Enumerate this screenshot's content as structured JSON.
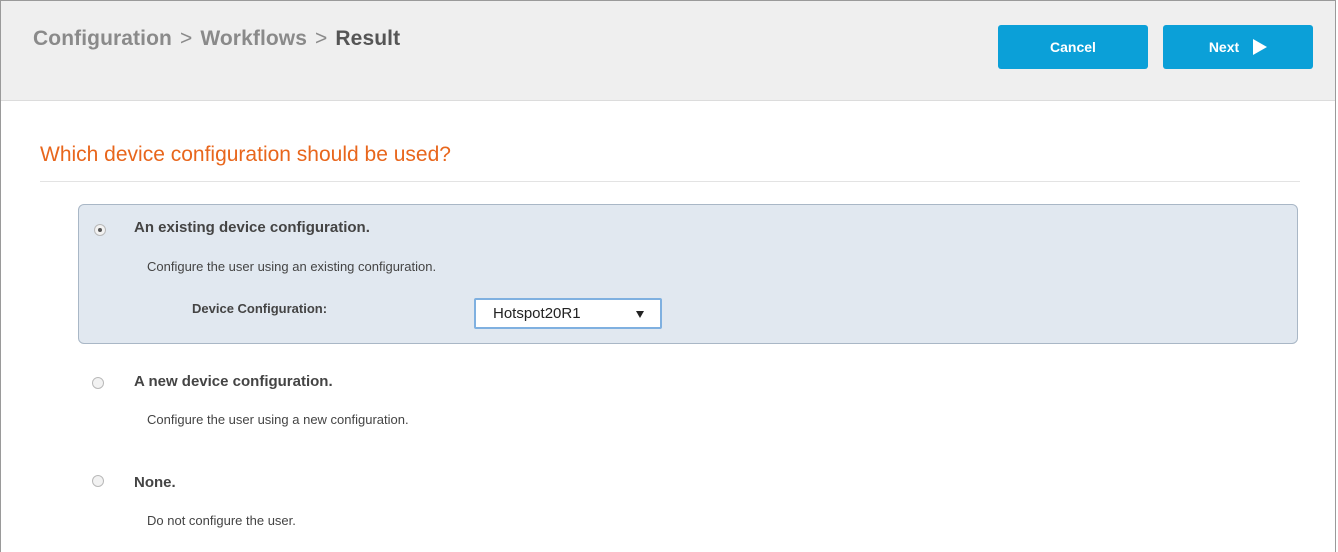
{
  "breadcrumb": {
    "item1": "Configuration",
    "item2": "Workflows",
    "current": "Result",
    "separator": ">"
  },
  "toolbar": {
    "cancel_label": "Cancel",
    "next_label": "Next"
  },
  "question": "Which device configuration should be used?",
  "options": [
    {
      "label": "An existing device configuration.",
      "description": "Configure the user using an existing configuration.",
      "selected": true
    },
    {
      "label": "A new device configuration.",
      "description": "Configure the user using a new configuration.",
      "selected": false
    },
    {
      "label": "None.",
      "description": "Do not configure the user.",
      "selected": false
    }
  ],
  "device_config": {
    "label": "Device Configuration:",
    "selected_value": "Hotspot20R1"
  },
  "colors": {
    "accent": "#0ba0d8",
    "question": "#e8661c",
    "panel": "#e1e8f0"
  },
  "icons": {
    "next": "play-arrow-icon",
    "dropdown": "caret-down-icon"
  }
}
